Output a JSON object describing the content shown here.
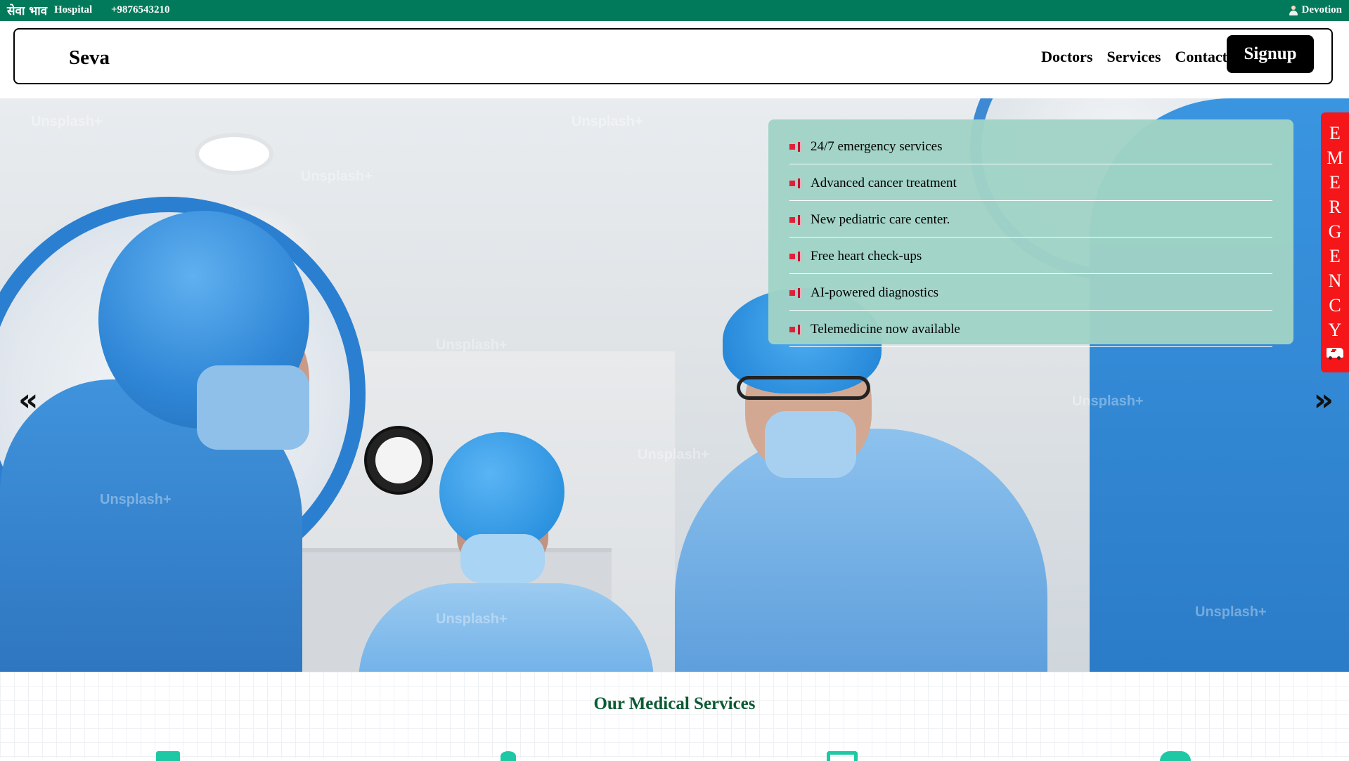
{
  "topbar": {
    "brand": "सेवा भाव",
    "hospital_label": "Hospital",
    "phone": "+9876543210",
    "user_name": "Devotion",
    "user_icon": "person-icon",
    "background": "#007a5a"
  },
  "navbar": {
    "logo": "Seva",
    "links": [
      "Doctors",
      "Services",
      "Contact"
    ],
    "signup_label": "Signup"
  },
  "hero": {
    "prev_arrow": "«",
    "next_arrow": "»",
    "watermark_text": "Unsplash+"
  },
  "news": {
    "bullet_icon": "pushpin-icon",
    "items": [
      "24/7 emergency services",
      "Advanced cancer treatment",
      "New pediatric care center.",
      "Free heart check-ups",
      "AI-powered diagnostics",
      "Telemedicine now available"
    ]
  },
  "emergency": {
    "letters": [
      "E",
      "M",
      "E",
      "R",
      "G",
      "E",
      "N",
      "C",
      "Y"
    ],
    "icon": "ambulance-icon",
    "color": "#f5161a"
  },
  "services": {
    "title": "Our Medical Services",
    "accent": "#1ec8a5",
    "title_color": "#0b5a33"
  }
}
